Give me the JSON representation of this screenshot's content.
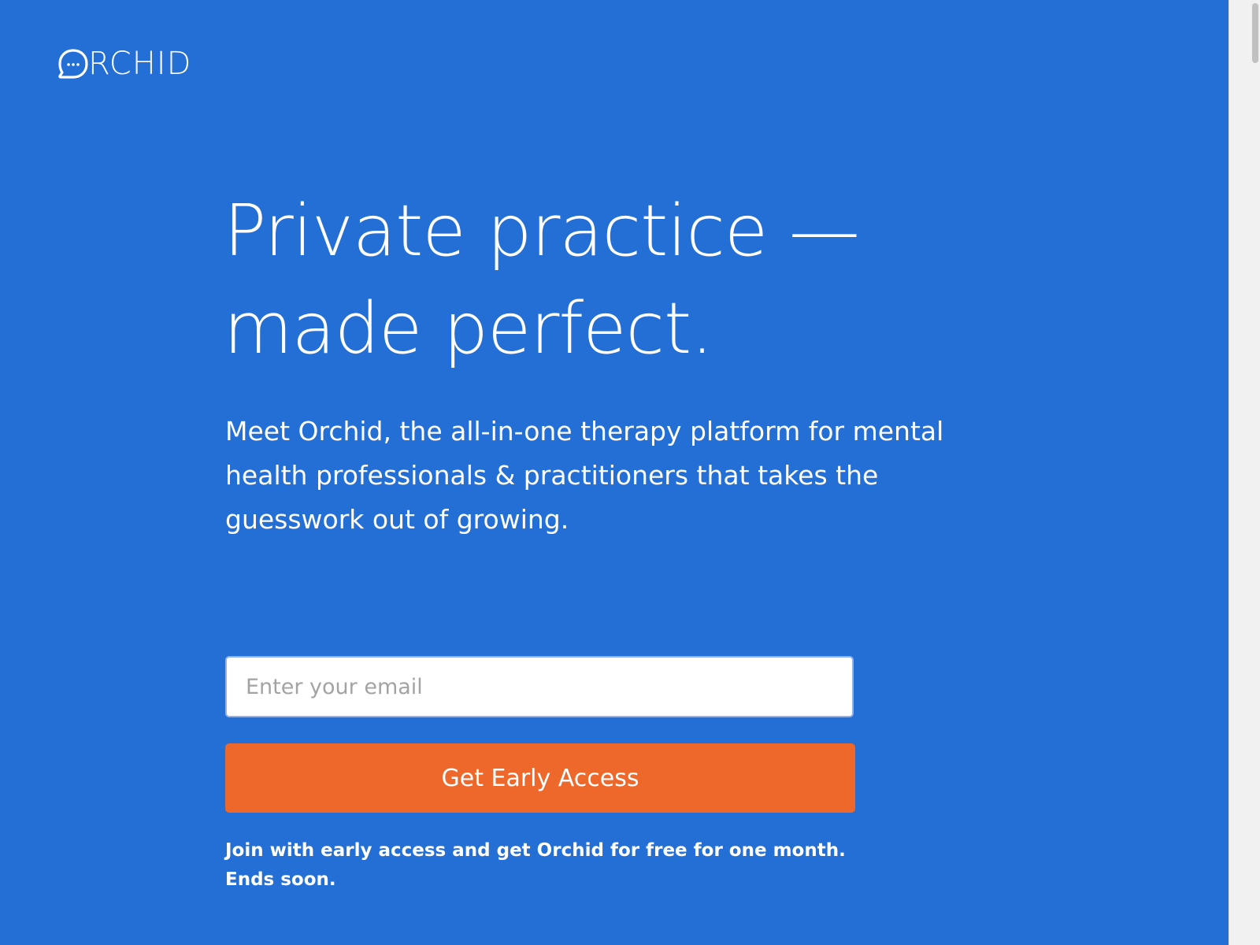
{
  "brand": {
    "logo_text": "RCHID",
    "logo_icon": "chat-bubble-icon"
  },
  "hero": {
    "headline_line1": "Private practice —",
    "headline_line2": "made perfect.",
    "subtitle": "Meet Orchid, the all-in-one therapy platform for mental health professionals & practitioners that takes the guesswork out of growing."
  },
  "signup": {
    "email_placeholder": "Enter your email",
    "email_value": "",
    "button_label": "Get Early Access",
    "note": "Join with early access and get Orchid for free for one month. Ends soon."
  },
  "colors": {
    "background": "#246fd6",
    "button": "#ee682c",
    "text": "#ffffff"
  }
}
